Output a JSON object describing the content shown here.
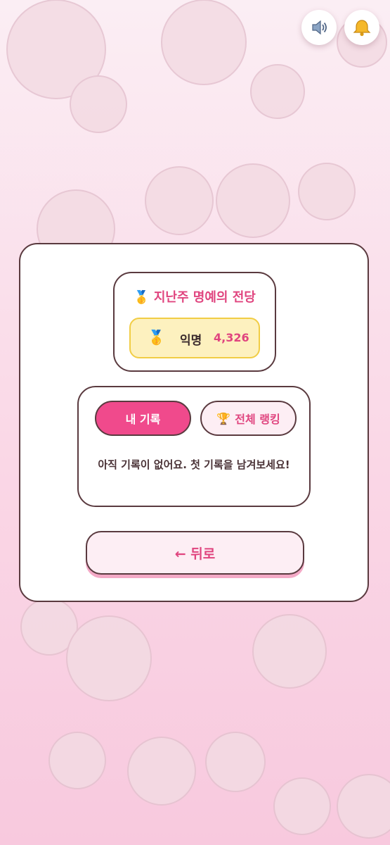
{
  "top_controls": {
    "sound_icon": "speaker-icon",
    "notification_icon": "bell-icon"
  },
  "hall_of_fame": {
    "medal_icon": "🥇",
    "title": "지난주 명예의 전당",
    "entry": {
      "medal": "🥇",
      "name": "익명",
      "score": "4,326"
    }
  },
  "records": {
    "tabs": [
      {
        "label": "내 기록",
        "active": true
      },
      {
        "label": "전체 랭킹",
        "icon": "🏆",
        "active": false
      }
    ],
    "empty_message": "아직 기록이 없어요. 첫 기록을 남겨보세요!"
  },
  "back_button": {
    "label": "← 뒤로"
  },
  "colors": {
    "accent": "#f04a8c",
    "accent_text": "#e0457f",
    "border": "#5a3a3f",
    "gold_bg": "#fdf1bf",
    "gold_border": "#f1cd45"
  }
}
